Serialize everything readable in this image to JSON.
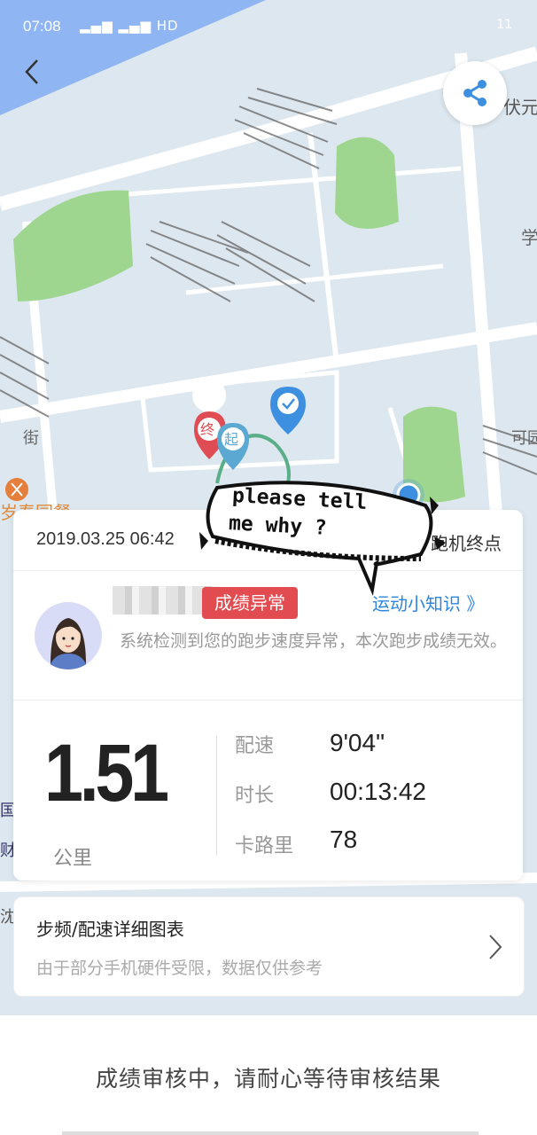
{
  "status_bar": {
    "time": "07:08",
    "signal": "३३३",
    "battery": "11"
  },
  "map": {
    "labels": {
      "top_right": "伏元",
      "right_mid": "学",
      "left_jie": "街",
      "right_kexue": "可园",
      "left_food": "岁春园餐",
      "left_guo": "国",
      "left_cai": "财",
      "left_street": "沈阳大街"
    },
    "start_marker": "起",
    "end_marker": "终"
  },
  "sticker": {
    "line1": "please tell",
    "line2": "me why ?"
  },
  "record": {
    "datetime": "2019.03.25 06:42",
    "end_point": "跑机终点",
    "status_badge": "成绩异常",
    "tips_link": "运动小知识 》",
    "message": "系统检测到您的跑步速度异常，本次跑步成绩无效。",
    "distance": "1.51",
    "distance_unit": "公里",
    "stats": [
      {
        "label": "配速",
        "value": "9'04\""
      },
      {
        "label": "时长",
        "value": "00:13:42"
      },
      {
        "label": "卡路里",
        "value": "78"
      }
    ]
  },
  "chart_entry": {
    "title": "步频/配速详细图表",
    "subtitle": "由于部分手机硬件受限，数据仅供参考"
  },
  "footer": {
    "status": "成绩审核中，请耐心等待审核结果"
  },
  "colors": {
    "route": "#5aae88",
    "badge": "#e24b50",
    "link": "#2c86e0",
    "map_green": "#9fd68f",
    "water": "#8fb5f2"
  }
}
